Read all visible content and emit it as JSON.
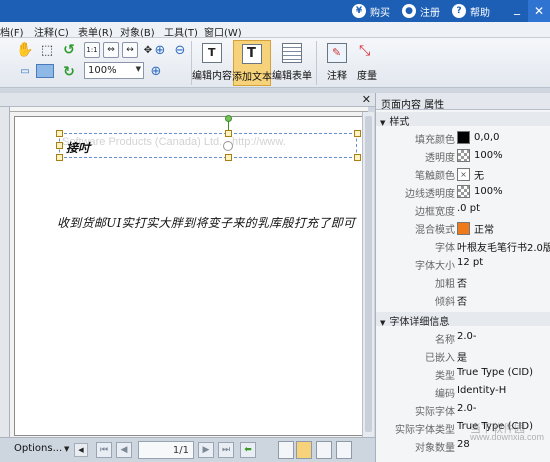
{
  "titlebar": {
    "buy_label": "购买",
    "register_label": "注册",
    "help_label": "帮助",
    "help_glyph": "?"
  },
  "menu": [
    "档(F)",
    "注释(C)",
    "表单(R)",
    "对象(B)",
    "工具(T)",
    "窗口(W)"
  ],
  "toolbar": {
    "zoom_value": "100%",
    "page_fit_label": "1:1",
    "edit_content_label": "编辑内容",
    "add_text_label": "添加文本",
    "edit_form_label": "编辑表单",
    "annotation_label": "注释",
    "measure_label": "度量"
  },
  "document": {
    "watermark_text": "Software Products (Canada) Ltd. - http://www.",
    "edit_text": "接吋",
    "handwriting_text": "收到货邮UI实打实大胖到将变子来的乳库殷打充了即可写呢"
  },
  "bottom": {
    "options_label": "Options...",
    "page_value": "1/1"
  },
  "properties": {
    "title": "页面内容 属性",
    "section_style": "样式",
    "section_font_detail": "字体详细信息",
    "rows_style": [
      {
        "key": "填充颜色",
        "value": "0,0,0",
        "swatch": "black"
      },
      {
        "key": "透明度",
        "value": "100%",
        "swatch": "check"
      },
      {
        "key": "笔触颜色",
        "value": "无",
        "swatch": "none"
      },
      {
        "key": "边线透明度",
        "value": "100%",
        "swatch": "check"
      },
      {
        "key": "边框宽度",
        "value": ".0 pt",
        "swatch": ""
      },
      {
        "key": "混合模式",
        "value": "正常",
        "swatch": "orange"
      },
      {
        "key": "字体",
        "value": "叶根友毛笔行书2.0版",
        "swatch": ""
      },
      {
        "key": "字体大小",
        "value": "12 pt",
        "swatch": ""
      },
      {
        "key": "加粗",
        "value": "否",
        "swatch": ""
      },
      {
        "key": "倾斜",
        "value": "否",
        "swatch": ""
      }
    ],
    "rows_font": [
      {
        "key": "名称",
        "value": "2.0-"
      },
      {
        "key": "已嵌入",
        "value": "是"
      },
      {
        "key": "类型",
        "value": "True Type (CID)"
      },
      {
        "key": "编码",
        "value": "Identity-H"
      },
      {
        "key": "实际字体",
        "value": "2.0-"
      },
      {
        "key": "实际字体类型",
        "value": "True Type (CID)"
      },
      {
        "key": "对象数量",
        "value": "28"
      }
    ]
  },
  "watermark_site": {
    "name": "当下软件园",
    "url": "www.downxia.com"
  },
  "colors": {
    "titlebar": "#1d5fb5",
    "active_button": "#f6d27a"
  }
}
